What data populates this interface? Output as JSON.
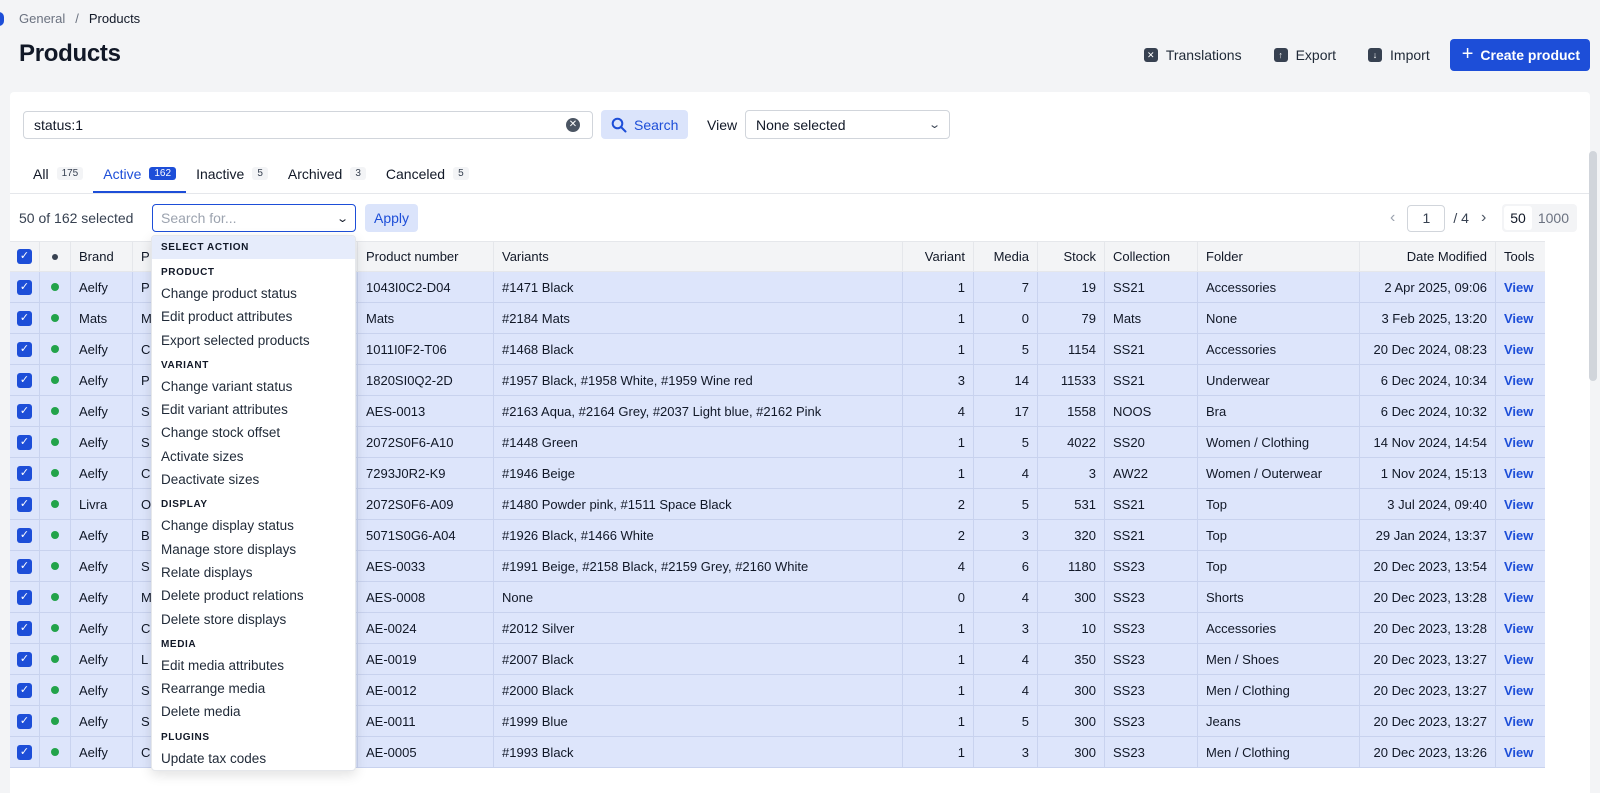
{
  "breadcrumb": {
    "parent": "General",
    "separator": "/",
    "current": "Products"
  },
  "page_title": "Products",
  "header_actions": {
    "translations": "Translations",
    "export": "Export",
    "import": "Import",
    "create": "Create product"
  },
  "search": {
    "value": "status:1",
    "button": "Search"
  },
  "view": {
    "label": "View",
    "selected": "None selected"
  },
  "tabs": [
    {
      "label": "All",
      "count": "175"
    },
    {
      "label": "Active",
      "count": "162"
    },
    {
      "label": "Inactive",
      "count": "5"
    },
    {
      "label": "Archived",
      "count": "3"
    },
    {
      "label": "Canceled",
      "count": "5"
    }
  ],
  "bulk": {
    "selected_text": "50 of 162 selected",
    "action_placeholder": "Search for...",
    "apply": "Apply"
  },
  "pagination": {
    "current": "1",
    "total": "/ 4",
    "sizes": [
      "50",
      "1000"
    ]
  },
  "columns": {
    "brand": "Brand",
    "product_name": "P",
    "product_number": "Product number",
    "variants": "Variants",
    "variant_count": "Variant",
    "media": "Media",
    "stock": "Stock",
    "collection": "Collection",
    "folder": "Folder",
    "date_modified": "Date Modified",
    "tools": "Tools"
  },
  "rows": [
    {
      "brand": "Aelfy",
      "name": "P",
      "number": "1043I0C2-D04",
      "variants": "#1471 Black",
      "vcount": "1",
      "media": "7",
      "stock": "19",
      "collection": "SS21",
      "folder": "Accessories",
      "date": "2 Apr 2025, 09:06",
      "tool": "View"
    },
    {
      "brand": "Mats",
      "name": "M",
      "number": "Mats",
      "variants": "#2184 Mats",
      "vcount": "1",
      "media": "0",
      "stock": "79",
      "collection": "Mats",
      "folder": "None",
      "date": "3 Feb 2025, 13:20",
      "tool": "View"
    },
    {
      "brand": "Aelfy",
      "name": "C",
      "number": "1011I0F2-T06",
      "variants": "#1468 Black",
      "vcount": "1",
      "media": "5",
      "stock": "1154",
      "collection": "SS21",
      "folder": "Accessories",
      "date": "20 Dec 2024, 08:23",
      "tool": "View"
    },
    {
      "brand": "Aelfy",
      "name": "P",
      "number": "1820SI0Q2-2D",
      "variants": "#1957 Black, #1958 White, #1959 Wine red",
      "vcount": "3",
      "media": "14",
      "stock": "11533",
      "collection": "SS21",
      "folder": "Underwear",
      "date": "6 Dec 2024, 10:34",
      "tool": "View"
    },
    {
      "brand": "Aelfy",
      "name": "S",
      "number": "AES-0013",
      "variants": "#2163 Aqua, #2164 Grey, #2037 Light blue, #2162 Pink",
      "vcount": "4",
      "media": "17",
      "stock": "1558",
      "collection": "NOOS",
      "folder": "Bra",
      "date": "6 Dec 2024, 10:32",
      "tool": "View"
    },
    {
      "brand": "Aelfy",
      "name": "S",
      "number": "2072S0F6-A10",
      "variants": "#1448 Green",
      "vcount": "1",
      "media": "5",
      "stock": "4022",
      "collection": "SS20",
      "folder": "Women / Clothing",
      "date": "14 Nov 2024, 14:54",
      "tool": "View"
    },
    {
      "brand": "Aelfy",
      "name": "C",
      "number": "7293J0R2-K9",
      "variants": "#1946 Beige",
      "vcount": "1",
      "media": "4",
      "stock": "3",
      "collection": "AW22",
      "folder": "Women / Outerwear",
      "date": "1 Nov 2024, 15:13",
      "tool": "View"
    },
    {
      "brand": "Livra",
      "name": "O",
      "number": "2072S0F6-A09",
      "variants": "#1480 Powder pink, #1511 Space Black",
      "vcount": "2",
      "media": "5",
      "stock": "531",
      "collection": "SS21",
      "folder": "Top",
      "date": "3 Jul 2024, 09:40",
      "tool": "View"
    },
    {
      "brand": "Aelfy",
      "name": "B",
      "number": "5071S0G6-A04",
      "variants": "#1926 Black, #1466 White",
      "vcount": "2",
      "media": "3",
      "stock": "320",
      "collection": "SS21",
      "folder": "Top",
      "date": "29 Jan 2024, 13:37",
      "tool": "View"
    },
    {
      "brand": "Aelfy",
      "name": "S",
      "number": "AES-0033",
      "variants": "#1991 Beige, #2158 Black, #2159 Grey, #2160 White",
      "vcount": "4",
      "media": "6",
      "stock": "1180",
      "collection": "SS23",
      "folder": "Top",
      "date": "20 Dec 2023, 13:54",
      "tool": "View"
    },
    {
      "brand": "Aelfy",
      "name": "M",
      "number": "AES-0008",
      "variants": "None",
      "vcount": "0",
      "media": "4",
      "stock": "300",
      "collection": "SS23",
      "folder": "Shorts",
      "date": "20 Dec 2023, 13:28",
      "tool": "View"
    },
    {
      "brand": "Aelfy",
      "name": "C",
      "number": "AE-0024",
      "variants": "#2012 Silver",
      "vcount": "1",
      "media": "3",
      "stock": "10",
      "collection": "SS23",
      "folder": "Accessories",
      "date": "20 Dec 2023, 13:28",
      "tool": "View"
    },
    {
      "brand": "Aelfy",
      "name": "L",
      "number": "AE-0019",
      "variants": "#2007 Black",
      "vcount": "1",
      "media": "4",
      "stock": "350",
      "collection": "SS23",
      "folder": "Men / Shoes",
      "date": "20 Dec 2023, 13:27",
      "tool": "View"
    },
    {
      "brand": "Aelfy",
      "name": "S",
      "number": "AE-0012",
      "variants": "#2000 Black",
      "vcount": "1",
      "media": "4",
      "stock": "300",
      "collection": "SS23",
      "folder": "Men / Clothing",
      "date": "20 Dec 2023, 13:27",
      "tool": "View"
    },
    {
      "brand": "Aelfy",
      "name": "S",
      "number": "AE-0011",
      "variants": "#1999 Blue",
      "vcount": "1",
      "media": "5",
      "stock": "300",
      "collection": "SS23",
      "folder": "Jeans",
      "date": "20 Dec 2023, 13:27",
      "tool": "View"
    },
    {
      "brand": "Aelfy",
      "name": "C",
      "number": "AE-0005",
      "variants": "#1993 Black",
      "vcount": "1",
      "media": "3",
      "stock": "300",
      "collection": "SS23",
      "folder": "Men / Clothing",
      "date": "20 Dec 2023, 13:26",
      "tool": "View"
    }
  ],
  "action_menu": {
    "title": "SELECT ACTION",
    "groups": [
      {
        "label": "PRODUCT",
        "items": [
          "Change product status",
          "Edit product attributes",
          "Export selected products"
        ]
      },
      {
        "label": "VARIANT",
        "items": [
          "Change variant status",
          "Edit variant attributes",
          "Change stock offset",
          "Activate sizes",
          "Deactivate sizes"
        ]
      },
      {
        "label": "DISPLAY",
        "items": [
          "Change display status",
          "Manage store displays",
          "Relate displays",
          "Delete product relations",
          "Delete store displays"
        ]
      },
      {
        "label": "MEDIA",
        "items": [
          "Edit media attributes",
          "Rearrange media",
          "Delete media"
        ]
      },
      {
        "label": "PLUGINS",
        "items": [
          "Update tax codes"
        ]
      }
    ]
  },
  "colors": {
    "accent": "#1d4ed8",
    "selected_row": "#dde5fb",
    "status_active": "#22a34a"
  }
}
